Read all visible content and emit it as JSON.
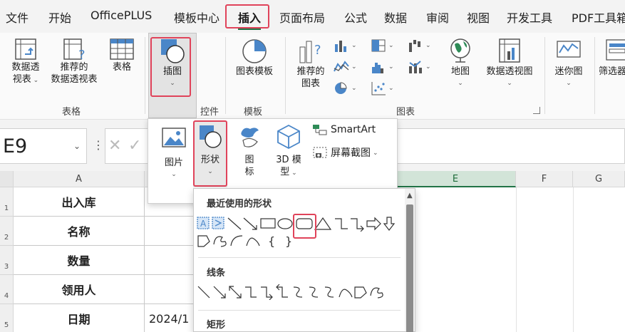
{
  "tabs": [
    {
      "label": "文件",
      "active": false
    },
    {
      "label": "开始",
      "active": false
    },
    {
      "label": "OfficePLUS",
      "active": false
    },
    {
      "label": "模板中心",
      "active": false
    },
    {
      "label": "插入",
      "active": true
    },
    {
      "label": "页面布局",
      "active": false
    },
    {
      "label": "公式",
      "active": false
    },
    {
      "label": "数据",
      "active": false
    },
    {
      "label": "审阅",
      "active": false
    },
    {
      "label": "视图",
      "active": false
    },
    {
      "label": "开发工具",
      "active": false
    },
    {
      "label": "PDF工具箱",
      "active": false
    }
  ],
  "ribbon": {
    "pivot_table": {
      "line1": "数据透",
      "line2": "视表"
    },
    "recommended_pivot": {
      "line1": "推荐的",
      "line2": "数据透视表"
    },
    "table": {
      "label": "表格"
    },
    "illustrations": {
      "label": "插图"
    },
    "chart_template": {
      "label": "图表模板"
    },
    "recommended_charts": {
      "line1": "推荐的",
      "line2": "图表"
    },
    "map": {
      "label": "地图"
    },
    "pivot_chart": {
      "label": "数据透视图"
    },
    "sparkline": {
      "label": "迷你图"
    },
    "filter": {
      "label": "筛选器"
    },
    "groups": {
      "tables": "表格",
      "controls": "控件",
      "templates": "模板",
      "charts": "图表"
    }
  },
  "formula_bar": {
    "name_box": "E9"
  },
  "grid": {
    "columns": [
      "A",
      "E",
      "F",
      "G"
    ],
    "row_numbers": [
      "1",
      "2",
      "3",
      "4",
      "5"
    ],
    "labels": [
      "出入库",
      "名称",
      "数量",
      "领用人",
      "日期"
    ],
    "date_partial": "2024/1"
  },
  "illustrations_menu": {
    "pictures": "图片",
    "shapes": "形状",
    "icons": {
      "line1": "图",
      "line2": "标"
    },
    "models3d": {
      "line1": "3D 模",
      "line2": "型"
    },
    "smartart": "SmartArt",
    "screenshot": "屏幕截图"
  },
  "shapes_panel": {
    "recent_title": "最近使用的形状",
    "lines_title": "线条",
    "rect_title": "矩形",
    "text_box_glyph": "A",
    "brace_open": "{",
    "brace_close": "}"
  },
  "colors": {
    "accent_green": "#217346",
    "highlight_red": "#e0435a",
    "icon_blue": "#4a86c8"
  }
}
